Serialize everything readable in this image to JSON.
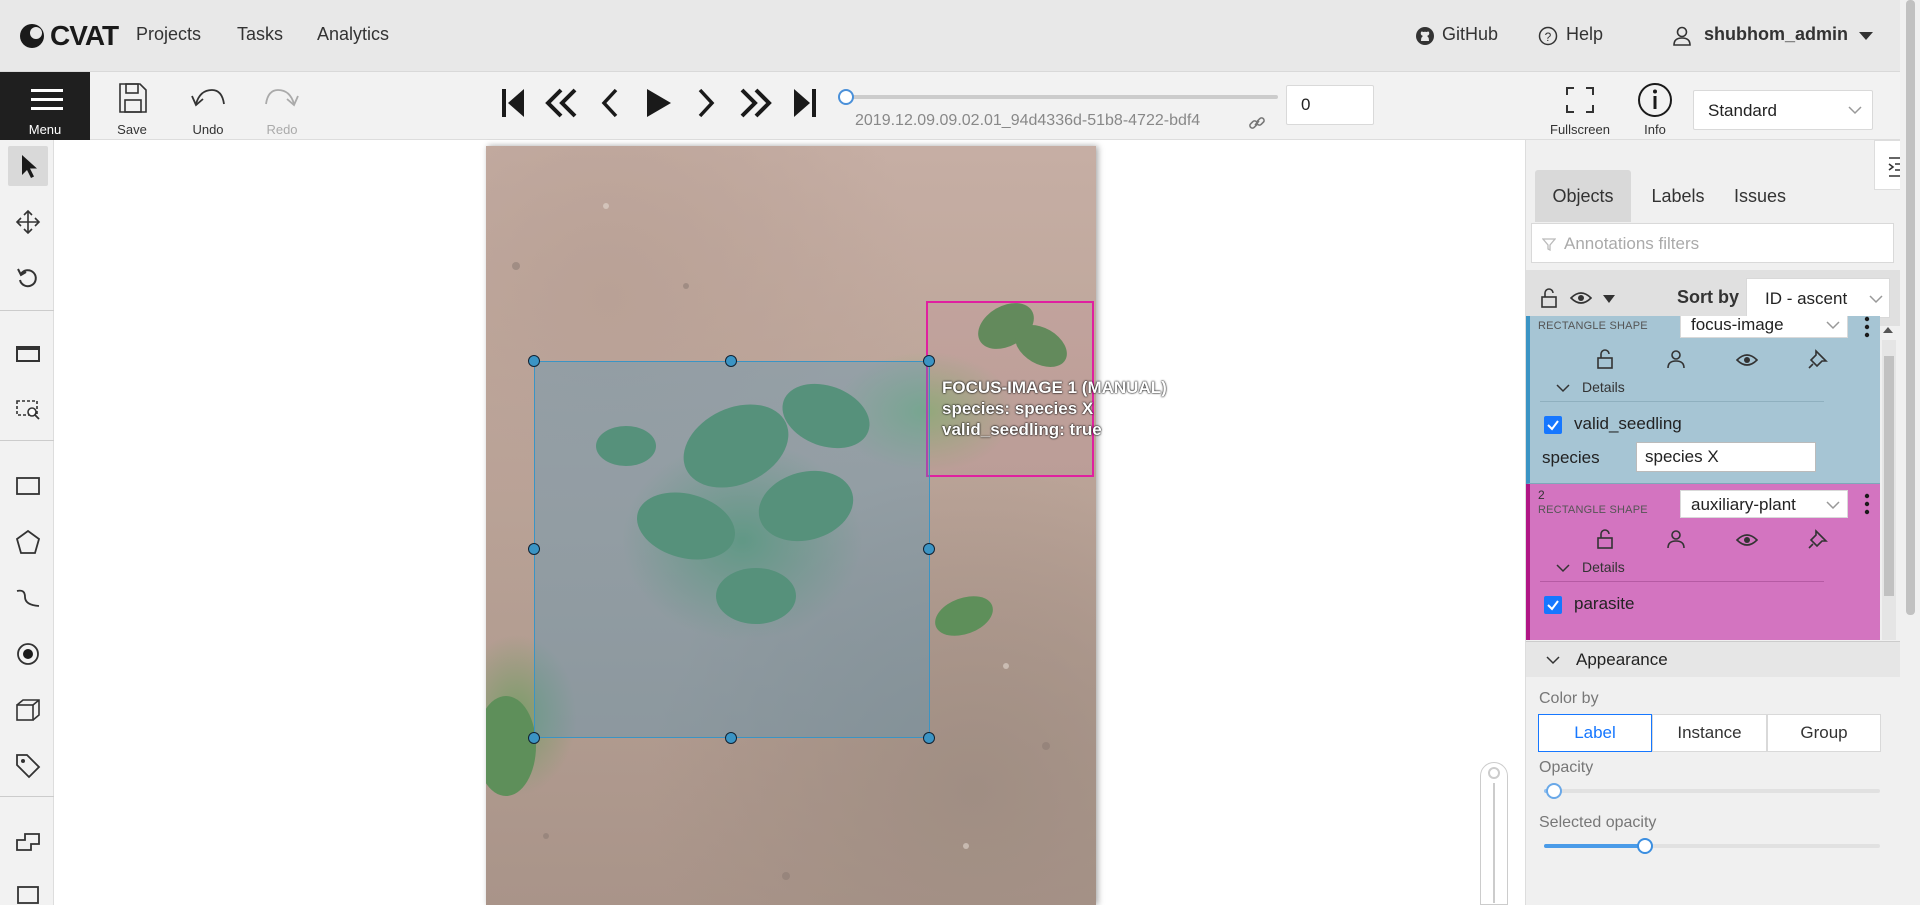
{
  "header": {
    "brand": "CVAT",
    "nav": [
      "Projects",
      "Tasks",
      "Analytics"
    ],
    "github": "GitHub",
    "help": "Help",
    "user": "shubhom_admin"
  },
  "toolbar": {
    "menu_label": "Menu",
    "save_label": "Save",
    "undo_label": "Undo",
    "redo_label": "Redo",
    "frame_name": "2019.12.09.09.02.01_94d4336d-51b8-4722-bdf4",
    "frame_number": "0",
    "fullscreen_label": "Fullscreen",
    "info_label": "Info",
    "workspace": "Standard",
    "frame_progress": 0
  },
  "canvas": {
    "overlay_title": "FOCUS-IMAGE 1 (MANUAL)",
    "overlay_species": "species: species X",
    "overlay_seedling": "valid_seedling: true",
    "colors": {
      "focus": "#3b94c4",
      "aux": "#e020a0"
    }
  },
  "sidebar": {
    "tabs": [
      "Objects",
      "Labels",
      "Issues"
    ],
    "filter_placeholder": "Annotations filters",
    "sort_label": "Sort by",
    "sort_value": "ID - ascent",
    "objects": [
      {
        "id": "",
        "type": "RECTANGLE SHAPE",
        "label": "focus-image",
        "details_label": "Details",
        "checkbox_label": "valid_seedling",
        "attr_name": "species",
        "attr_value": "species X",
        "color": "#a6c5d4"
      },
      {
        "id": "2",
        "type": "RECTANGLE SHAPE",
        "label": "auxiliary-plant",
        "details_label": "Details",
        "checkbox_label": "parasite",
        "color": "#d374c0"
      }
    ],
    "appearance": {
      "title": "Appearance",
      "color_by_label": "Color by",
      "color_by_options": [
        "Label",
        "Instance",
        "Group"
      ],
      "color_by_selected": "Label",
      "opacity_label": "Opacity",
      "opacity_value": 0.03,
      "selected_opacity_label": "Selected opacity",
      "selected_opacity_value": 0.3
    }
  }
}
